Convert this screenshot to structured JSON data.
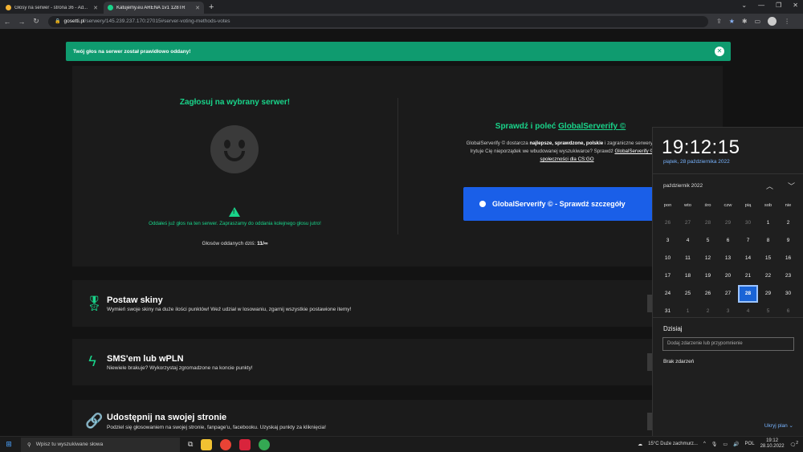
{
  "browser": {
    "tabs": [
      {
        "title": "Głosy na serwer - strona 36 - Ad...",
        "active": false,
        "favicon_color": "#f2b233"
      },
      {
        "title": "Katujemy.eu ARENA 1v1 128TR",
        "active": true,
        "favicon_color": "#19d48a"
      }
    ],
    "new_tab": "+",
    "window_controls": [
      "⌄",
      "—",
      "❐",
      "✕"
    ],
    "address": {
      "domain": "gosetti.pl",
      "path": "/serwery/145.239.237.170:27015#server-voting-methods-votes"
    }
  },
  "alert": {
    "text": "Twój głos na serwer został prawidłowo oddany!",
    "close": "✕"
  },
  "vote": {
    "title": "Zagłosuj na wybrany serwer!",
    "already_voted": "Oddałeś już głos na ten serwer. Zapraszamy do oddania kolejnego głosu jutro!",
    "warn_glyph": "!",
    "count_label": "Głosów oddanych dziś:",
    "count_value": "11/∞"
  },
  "globalserverify": {
    "title_prefix": "Sprawdź i poleć",
    "title_link": "GlobalServerify ©",
    "text_1": "GlobalServerify © dostarcza",
    "text_bold": "najlepsze, sprawdzone, polskie",
    "text_2": "i zagraniczne serwery bezpo",
    "text_3": "Irytuje Cię nieporządek we wbudowanej wyszukiwarce? Sprawdź",
    "text_link1": "GlobalServerify © - do",
    "text_link2": "społeczności dla CS:GO",
    "button": "GlobalServerify © - Sprawdź szczegóły"
  },
  "features": [
    {
      "icon": "🎖",
      "title": "Postaw skiny",
      "desc": "Wymień swoje skiny na duże ilości punktów! Weź udział w losowaniu, zgarnij wszystkie postawione itemy!"
    },
    {
      "icon": "ϟ",
      "title": "SMS'em lub wPLN",
      "desc": "Niewiele brakuje? Wykorzystaj zgromadzone na koncie punkty!"
    },
    {
      "icon": "🔗",
      "title": "Udostępnij na swojej stronie",
      "desc": "Podziel się głosowaniem na swojej stronie, fanpage'u, facebooku. Uzyskaj punkty za kliknięcia!"
    }
  ],
  "calendar": {
    "time": "19:12:15",
    "date": "piątek, 28 października 2022",
    "month": "październik 2022",
    "weekdays": [
      "pon",
      "wto",
      "śro",
      "czw",
      "pią",
      "sob",
      "nie"
    ],
    "days": [
      [
        "26",
        "m"
      ],
      [
        "27",
        "m"
      ],
      [
        "28",
        "m"
      ],
      [
        "29",
        "m"
      ],
      [
        "30",
        "m"
      ],
      [
        "1",
        ""
      ],
      [
        "2",
        ""
      ],
      [
        "3",
        ""
      ],
      [
        "4",
        ""
      ],
      [
        "5",
        ""
      ],
      [
        "6",
        ""
      ],
      [
        "7",
        ""
      ],
      [
        "8",
        ""
      ],
      [
        "9",
        ""
      ],
      [
        "10",
        ""
      ],
      [
        "11",
        ""
      ],
      [
        "12",
        ""
      ],
      [
        "13",
        ""
      ],
      [
        "14",
        ""
      ],
      [
        "15",
        ""
      ],
      [
        "16",
        ""
      ],
      [
        "17",
        ""
      ],
      [
        "18",
        ""
      ],
      [
        "19",
        ""
      ],
      [
        "20",
        ""
      ],
      [
        "21",
        ""
      ],
      [
        "22",
        ""
      ],
      [
        "23",
        ""
      ],
      [
        "24",
        ""
      ],
      [
        "25",
        ""
      ],
      [
        "26",
        ""
      ],
      [
        "27",
        ""
      ],
      [
        "28",
        "t"
      ],
      [
        "29",
        ""
      ],
      [
        "30",
        ""
      ],
      [
        "31",
        ""
      ],
      [
        "1",
        "m"
      ],
      [
        "2",
        "m"
      ],
      [
        "3",
        "m"
      ],
      [
        "4",
        "m"
      ],
      [
        "5",
        "m"
      ],
      [
        "6",
        "m"
      ]
    ],
    "today_label": "Dzisiaj",
    "event_placeholder": "Dodaj zdarzenie lub przypomnienie",
    "no_events": "Brak zdarzeń",
    "hide_plan": "Ukryj plan ⌄"
  },
  "taskbar": {
    "search_placeholder": "Wpisz tu wyszukiwane słowa",
    "weather": "15°C  Duże zachmurz...",
    "lang": "POL",
    "time": "19:12",
    "date": "28.10.2022",
    "notif_count": "2"
  }
}
